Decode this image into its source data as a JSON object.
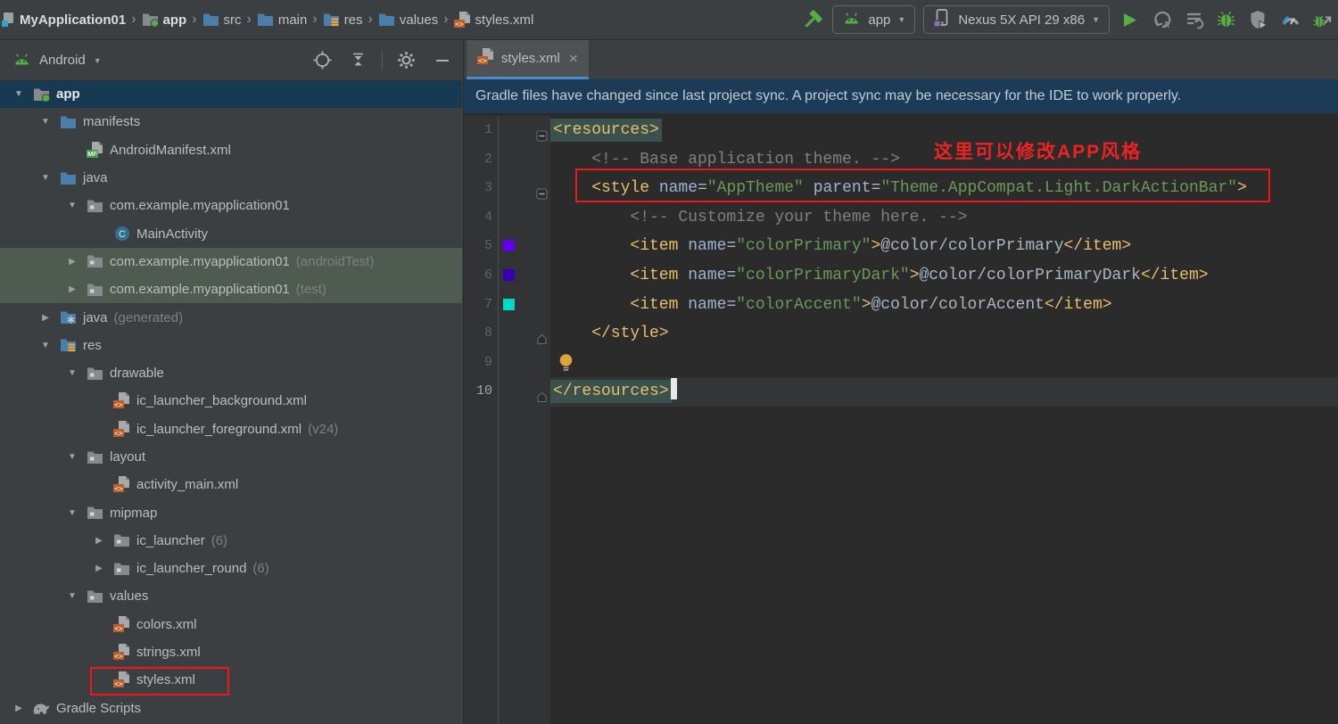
{
  "topbar": {
    "breadcrumbs": [
      {
        "label": "MyApplication01",
        "icon": "project-icon",
        "bold": true
      },
      {
        "label": "app",
        "icon": "folder-app-icon",
        "bold": true
      },
      {
        "label": "src",
        "icon": "folder-icon"
      },
      {
        "label": "main",
        "icon": "folder-icon"
      },
      {
        "label": "res",
        "icon": "folder-res-icon"
      },
      {
        "label": "values",
        "icon": "folder-icon"
      },
      {
        "label": "styles.xml",
        "icon": "xml-file-icon"
      }
    ],
    "run_config_label": "app",
    "device_label": "Nexus 5X API 29 x86"
  },
  "project_panel": {
    "view_selector_label": "Android",
    "tree": [
      {
        "label": "app",
        "icon": "folder-app-icon",
        "level": 0,
        "arrow": "expanded",
        "selected": true
      },
      {
        "label": "manifests",
        "icon": "folder-icon",
        "level": 1,
        "arrow": "expanded"
      },
      {
        "label": "AndroidManifest.xml",
        "icon": "manifest-file-icon",
        "level": 2
      },
      {
        "label": "java",
        "icon": "folder-icon",
        "level": 1,
        "arrow": "expanded"
      },
      {
        "label": "com.example.myapplication01",
        "icon": "folder-pkg-icon",
        "level": 2,
        "arrow": "expanded"
      },
      {
        "label": "MainActivity",
        "icon": "class-icon",
        "level": 3
      },
      {
        "label": "com.example.myapplication01",
        "suffix": "(androidTest)",
        "icon": "folder-pkg-icon",
        "level": 2,
        "arrow": "collapsed",
        "highlighted": true
      },
      {
        "label": "com.example.myapplication01",
        "suffix": "(test)",
        "icon": "folder-pkg-icon",
        "level": 2,
        "arrow": "collapsed",
        "highlighted": true
      },
      {
        "label": "java",
        "suffix": "(generated)",
        "icon": "java-gen-icon",
        "level": 1,
        "arrow": "collapsed"
      },
      {
        "label": "res",
        "icon": "folder-res-icon",
        "level": 1,
        "arrow": "expanded"
      },
      {
        "label": "drawable",
        "icon": "folder-pkg-icon",
        "level": 2,
        "arrow": "expanded"
      },
      {
        "label": "ic_launcher_background.xml",
        "icon": "xml-file-icon",
        "level": 3
      },
      {
        "label": "ic_launcher_foreground.xml",
        "suffix": "(v24)",
        "icon": "xml-file-icon",
        "level": 3
      },
      {
        "label": "layout",
        "icon": "folder-pkg-icon",
        "level": 2,
        "arrow": "expanded"
      },
      {
        "label": "activity_main.xml",
        "icon": "xml-file-icon",
        "level": 3
      },
      {
        "label": "mipmap",
        "icon": "folder-pkg-icon",
        "level": 2,
        "arrow": "expanded"
      },
      {
        "label": "ic_launcher",
        "suffix": "(6)",
        "icon": "folder-pkg-icon",
        "level": 3,
        "arrow": "collapsed"
      },
      {
        "label": "ic_launcher_round",
        "suffix": "(6)",
        "icon": "folder-pkg-icon",
        "level": 3,
        "arrow": "collapsed"
      },
      {
        "label": "values",
        "icon": "folder-pkg-icon",
        "level": 2,
        "arrow": "expanded"
      },
      {
        "label": "colors.xml",
        "icon": "xml-file-icon",
        "level": 3
      },
      {
        "label": "strings.xml",
        "icon": "xml-file-icon",
        "level": 3
      },
      {
        "label": "styles.xml",
        "icon": "xml-file-icon",
        "level": 3,
        "boxed": true
      },
      {
        "label": "Gradle Scripts",
        "icon": "gradle-icon",
        "level": 0,
        "arrow": "collapsed"
      }
    ]
  },
  "editor": {
    "tab_label": "styles.xml",
    "tab_close": "×",
    "notification_text": "Gradle files have changed since last project sync. A project sync may be necessary for the IDE to work properly.",
    "annotation_text": "这里可以修改APP风格",
    "code_lines": [
      {
        "num": "1",
        "indent": 0,
        "fold": "collapse",
        "tokens": [
          {
            "t": "<resources>",
            "c": "tag",
            "hl": true
          }
        ]
      },
      {
        "num": "2",
        "indent": 4,
        "tokens": [
          {
            "t": "<!-- Base application theme. -->",
            "c": "comment"
          }
        ]
      },
      {
        "num": "3",
        "indent": 4,
        "fold": "collapse",
        "tokens": [
          {
            "t": "<style",
            "c": "tag"
          },
          {
            "t": " ",
            "c": "plain"
          },
          {
            "t": "name",
            "c": "attr"
          },
          {
            "t": "=",
            "c": "plain"
          },
          {
            "t": "\"AppTheme\"",
            "c": "string"
          },
          {
            "t": " ",
            "c": "plain"
          },
          {
            "t": "parent",
            "c": "attr"
          },
          {
            "t": "=",
            "c": "plain"
          },
          {
            "t": "\"Theme.AppCompat.Light.DarkActionBar\"",
            "c": "string"
          },
          {
            "t": ">",
            "c": "tag"
          }
        ]
      },
      {
        "num": "4",
        "indent": 8,
        "tokens": [
          {
            "t": "<!-- Customize your theme here. -->",
            "c": "comment"
          }
        ]
      },
      {
        "num": "5",
        "indent": 8,
        "swatch": "#6200EE",
        "tokens": [
          {
            "t": "<item",
            "c": "tag"
          },
          {
            "t": " ",
            "c": "plain"
          },
          {
            "t": "name",
            "c": "attr"
          },
          {
            "t": "=",
            "c": "plain"
          },
          {
            "t": "\"colorPrimary\"",
            "c": "string"
          },
          {
            "t": ">",
            "c": "tag"
          },
          {
            "t": "@color/colorPrimary",
            "c": "plain"
          },
          {
            "t": "</item>",
            "c": "tag"
          }
        ]
      },
      {
        "num": "6",
        "indent": 8,
        "swatch": "#3700B3",
        "tokens": [
          {
            "t": "<item",
            "c": "tag"
          },
          {
            "t": " ",
            "c": "plain"
          },
          {
            "t": "name",
            "c": "attr"
          },
          {
            "t": "=",
            "c": "plain"
          },
          {
            "t": "\"colorPrimaryDark\"",
            "c": "string"
          },
          {
            "t": ">",
            "c": "tag"
          },
          {
            "t": "@color/colorPrimaryDark",
            "c": "plain"
          },
          {
            "t": "</item>",
            "c": "tag"
          }
        ]
      },
      {
        "num": "7",
        "indent": 8,
        "swatch": "#03DAC5",
        "tokens": [
          {
            "t": "<item",
            "c": "tag"
          },
          {
            "t": " ",
            "c": "plain"
          },
          {
            "t": "name",
            "c": "attr"
          },
          {
            "t": "=",
            "c": "plain"
          },
          {
            "t": "\"colorAccent\"",
            "c": "string"
          },
          {
            "t": ">",
            "c": "tag"
          },
          {
            "t": "@color/colorAccent",
            "c": "plain"
          },
          {
            "t": "</item>",
            "c": "tag"
          }
        ]
      },
      {
        "num": "8",
        "indent": 4,
        "fold": "end",
        "tokens": [
          {
            "t": "</style>",
            "c": "tag"
          }
        ]
      },
      {
        "num": "9",
        "indent": 0,
        "bulb": true,
        "tokens": []
      },
      {
        "num": "10",
        "indent": 0,
        "fold": "end",
        "current": true,
        "caret": true,
        "tokens": [
          {
            "t": "</resources>",
            "c": "tag",
            "hl": true
          }
        ]
      }
    ]
  },
  "colors": {
    "color_primary_swatch": "#6200EE",
    "color_primary_dark_swatch": "#3700B3",
    "color_accent_swatch": "#03DAC5",
    "annotation_red": "#F21616",
    "tab_underline_blue": "#4A88C7",
    "notification_banner_blue": "#1C3B57"
  }
}
